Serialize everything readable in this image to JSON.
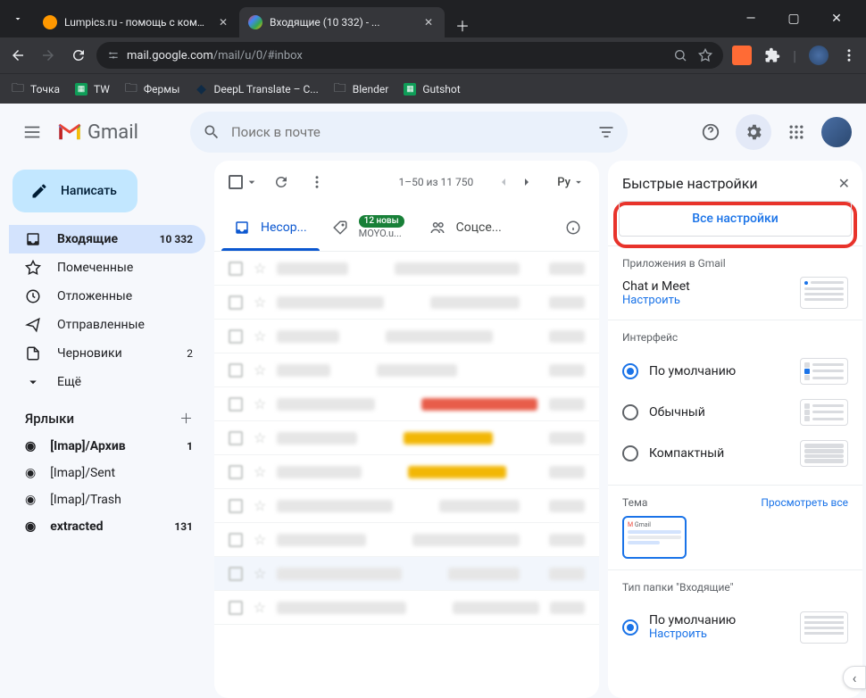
{
  "browser": {
    "tabs": [
      {
        "title": "Lumpics.ru - помощь с комп..."
      },
      {
        "title": "Входящие (10 332) - ..."
      }
    ],
    "url_host": "mail.google.com",
    "url_path": "/mail/u/0/#inbox",
    "bookmarks": [
      "Точка",
      "TW",
      "Фермы",
      "DeepL Translate – С...",
      "Blender",
      "Gutshot"
    ]
  },
  "gmail": {
    "brand": "Gmail",
    "search_placeholder": "Поиск в почте",
    "compose": "Написать",
    "nav": [
      {
        "label": "Входящие",
        "count": "10 332",
        "active": true
      },
      {
        "label": "Помеченные"
      },
      {
        "label": "Отложенные"
      },
      {
        "label": "Отправленные"
      },
      {
        "label": "Черновики",
        "count": "2"
      },
      {
        "label": "Ещё"
      }
    ],
    "labels_title": "Ярлыки",
    "labels": [
      {
        "label": "[Imap]/Архив",
        "count": "1",
        "bold": true
      },
      {
        "label": "[Imap]/Sent"
      },
      {
        "label": "[Imap]/Trash"
      },
      {
        "label": "extracted",
        "count": "131",
        "bold": true
      }
    ],
    "toolbar": {
      "page_info": "1–50 из 11 750",
      "lang": "Ру"
    },
    "categories": {
      "primary": "Несор...",
      "promo_badge": "12 новы",
      "promo_sub": "MOYO.u...",
      "social": "Соцсе..."
    },
    "settings": {
      "title": "Быстрые настройки",
      "all_settings": "Все настройки",
      "apps_title": "Приложения в Gmail",
      "apps_label": "Chat и Meet",
      "configure": "Настроить",
      "interface_title": "Интерфейс",
      "density": [
        "По умолчанию",
        "Обычный",
        "Компактный"
      ],
      "theme_title": "Тема",
      "theme_view_all": "Просмотреть все",
      "inbox_type_title": "Тип папки \"Входящие\"",
      "inbox_default": "По умолчанию"
    }
  }
}
